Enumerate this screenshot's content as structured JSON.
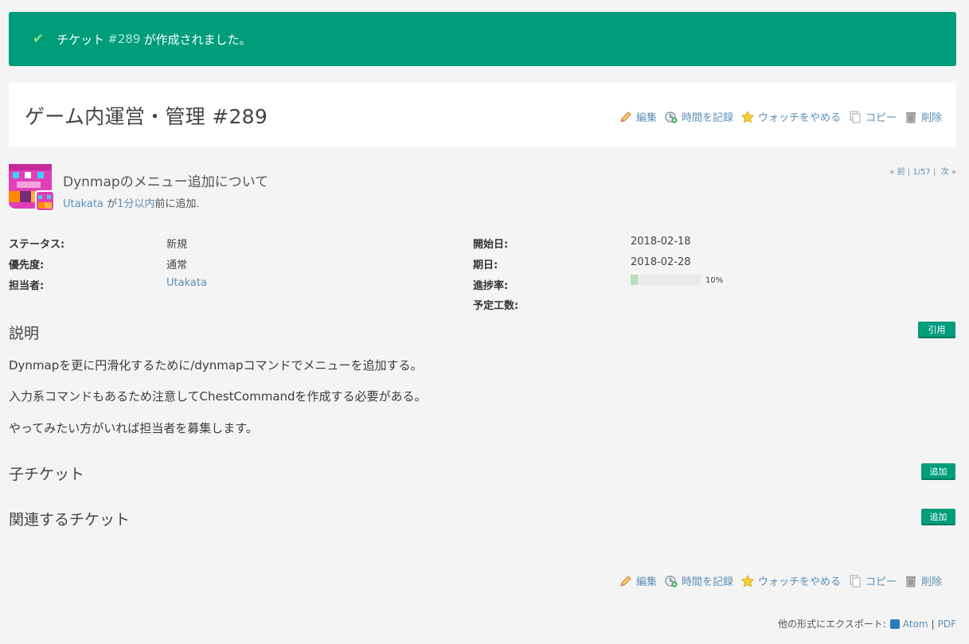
{
  "flash": {
    "prefix": "チケット",
    "ticket_link": "#289",
    "suffix": "が作成されました。"
  },
  "issue": {
    "title": "ゲーム内運営・管理 #289",
    "subject": "Dynmapのメニュー追加について",
    "author_name": "Utakata",
    "author_mid": "が",
    "time_link": "1分以内",
    "author_suffix": "前に追加."
  },
  "actions": {
    "edit": "編集",
    "log_time": "時間を記録",
    "unwatch": "ウォッチをやめる",
    "copy": "コピー",
    "delete": "削除"
  },
  "prevnext": {
    "prev": "« 前",
    "sep1": "|",
    "position": "1/57",
    "sep2": "|",
    "next": "次 »"
  },
  "attributes": {
    "status_label": "ステータス:",
    "status_value": "新規",
    "priority_label": "優先度:",
    "priority_value": "通常",
    "assignee_label": "担当者:",
    "assignee_value": "Utakata",
    "start_label": "開始日:",
    "start_value": "2018-02-18",
    "due_label": "期日:",
    "due_value": "2018-02-28",
    "progress_label": "進捗率:",
    "progress_percent": 10,
    "progress_text": "10%",
    "estimate_label": "予定工数:"
  },
  "description": {
    "heading": "説明",
    "quote_button": "引用",
    "lines": [
      "Dynmapを更に円滑化するために/dynmapコマンドでメニューを追加する。",
      "入力系コマンドもあるため注意してChestCommandを作成する必要がある。",
      "やってみたい方がいれば担当者を募集します。"
    ]
  },
  "subtasks": {
    "heading": "子チケット",
    "add_button": "追加"
  },
  "relations": {
    "heading": "関連するチケット",
    "add_button": "追加"
  },
  "export": {
    "label": "他の形式にエクスポート:",
    "atom": "Atom",
    "sep": "|",
    "pdf": "PDF"
  },
  "colors": {
    "accent": "#009d7b",
    "link": "#5b8fb9",
    "progress_fill": "#b6e0b8"
  },
  "icons": [
    "check-icon",
    "pencil-icon",
    "clock-add-icon",
    "star-icon",
    "copy-icon",
    "trash-icon",
    "rss-feed-icon"
  ]
}
